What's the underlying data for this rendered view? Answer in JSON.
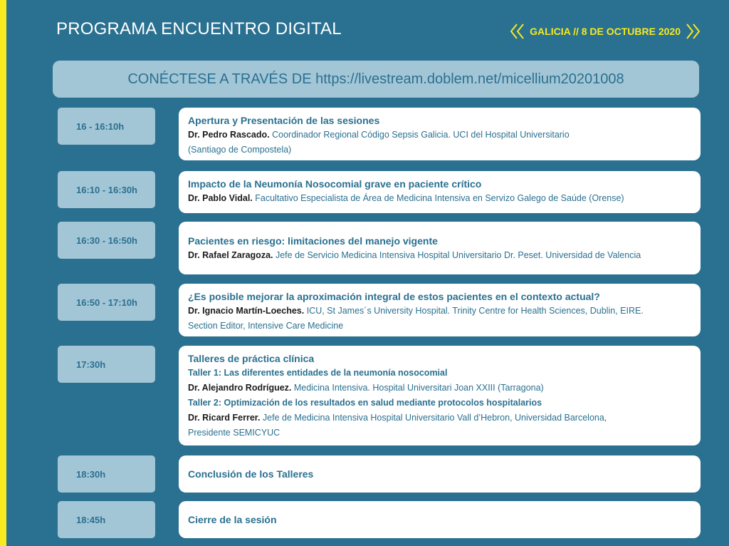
{
  "header": {
    "title": "PROGRAMA ENCUENTRO DIGITAL",
    "date": "GALICIA // 8 DE OCTUBRE 2020"
  },
  "banner": {
    "text": "CONÉCTESE A TRAVÉS DE https://livestream.doblem.net/micellium20201008"
  },
  "colors": {
    "background": "#2a7090",
    "accent": "#f7ea1f",
    "light": "#a3c6d6",
    "speaker": "#1b1b1b"
  },
  "icons": {
    "date_left": "double-chevron-left-icon",
    "date_right": "double-chevron-right-icon"
  },
  "sessions": [
    {
      "time": "16 - 16:10h",
      "title": "Apertura y Presentación de las sesiones",
      "speaker": "Dr. Pedro Rascado.",
      "desc": " Coordinador Regional Código Sepsis Galicia. UCI del Hospital Universitario",
      "desc2": "(Santiago de Compostela)"
    },
    {
      "time": "16:10 - 16:30h",
      "title": "Impacto de la Neumonía Nosocomial grave en paciente crítico",
      "speaker": "Dr. Pablo Vidal.",
      "desc": " Facultativo Especialista de Área de Medicina Intensiva en Servizo Galego de Saúde (Orense)"
    },
    {
      "time": "16:30 - 16:50h",
      "title": "Pacientes en riesgo: limitaciones del manejo vigente",
      "speaker": "Dr. Rafael Zaragoza.",
      "desc": " Jefe de Servicio Medicina Intensiva Hospital Universitario Dr. Peset. Universidad de Valencia"
    },
    {
      "time": "16:50 - 17:10h",
      "title": "¿Es posible mejorar la aproximación integral de estos pacientes en el contexto actual?",
      "speaker": "Dr. Ignacio Martín-Loeches.",
      "desc": " ICU, St James´s University Hospital. Trinity Centre for Health Sciences, Dublin, EIRE.",
      "desc2": "Section Editor, Intensive Care Medicine"
    },
    {
      "time": "17:30h",
      "title": "Talleres de práctica clínica",
      "taller1": {
        "title": "Taller 1: Las diferentes entidades de la neumonía nosocomial",
        "speaker": "Dr. Alejandro Rodríguez.",
        "desc": "  Medicina Intensiva. Hospital Universitari Joan XXIII (Tarragona)"
      },
      "taller2": {
        "title": "Taller 2: Optimización de los resultados en salud mediante protocolos hospitalarios",
        "speaker": "Dr. Ricard Ferrer.",
        "desc": " Jefe de Medicina Intensiva Hospital Universitario Vall d’Hebron, Universidad Barcelona,",
        "desc2": "Presidente SEMICYUC"
      }
    },
    {
      "time": "18:30h",
      "title": "Conclusión de los Talleres"
    },
    {
      "time": "18:45h",
      "title": "Cierre de la sesión"
    }
  ]
}
